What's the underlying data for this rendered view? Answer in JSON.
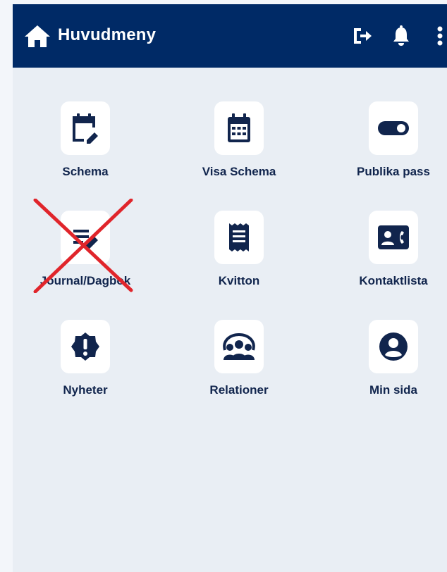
{
  "header": {
    "title": "Huvudmeny",
    "bg_color": "#002a66",
    "icons": [
      "home-icon",
      "logout-icon",
      "bell-icon",
      "more-vertical-icon"
    ]
  },
  "menu": {
    "items": [
      {
        "label": "Schema",
        "icon": "calendar-edit-icon"
      },
      {
        "label": "Visa Schema",
        "icon": "calendar-grid-icon"
      },
      {
        "label": "Publika pass",
        "icon": "toggle-icon"
      },
      {
        "label": "Journal/Dagbok",
        "icon": "note-edit-icon",
        "crossed_out": true
      },
      {
        "label": "Kvitton",
        "icon": "receipt-icon"
      },
      {
        "label": "Kontaktlista",
        "icon": "contact-card-icon"
      },
      {
        "label": "Nyheter",
        "icon": "alert-badge-icon"
      },
      {
        "label": "Relationer",
        "icon": "group-icon"
      },
      {
        "label": "Min sida",
        "icon": "user-circle-icon"
      }
    ]
  },
  "colors": {
    "primary": "#002a66",
    "icon": "#11254d",
    "background": "#e9eef4",
    "cross": "#e0252b"
  }
}
